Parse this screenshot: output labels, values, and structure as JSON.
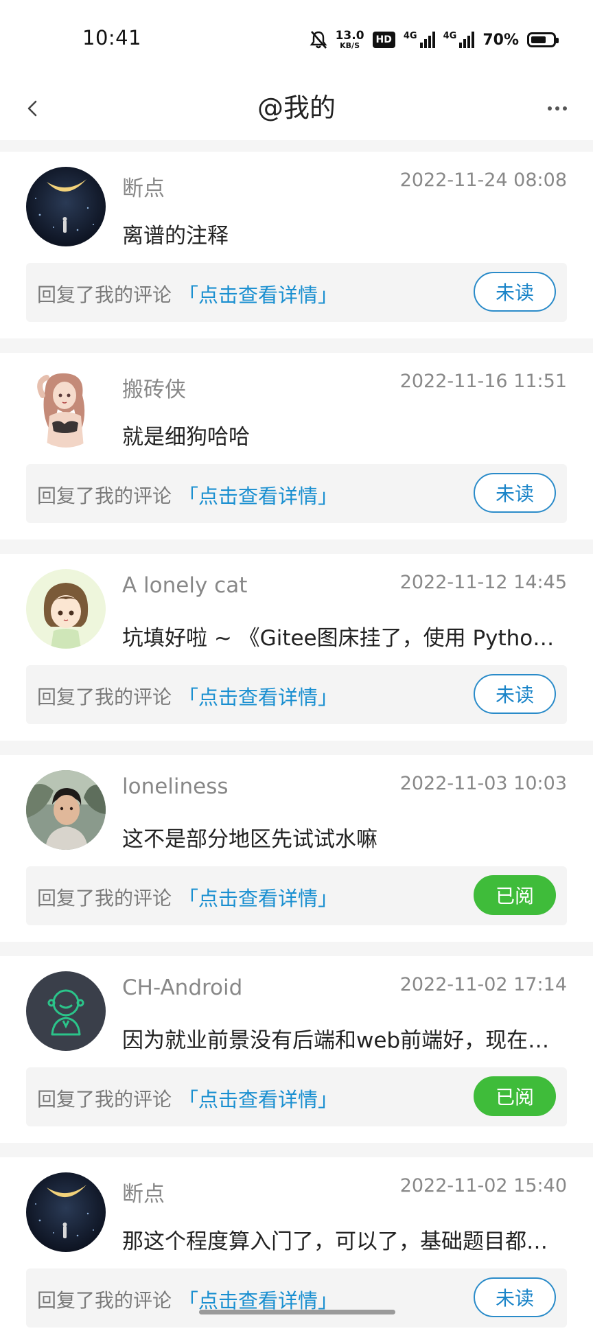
{
  "status_bar": {
    "time": "10:41",
    "net_speed_value": "13.0",
    "net_speed_unit": "KB/S",
    "hd_label": "HD",
    "sig1_label": "4G",
    "sig2_label": "4G",
    "battery_percent": "70%",
    "battery_level": 0.7
  },
  "nav": {
    "title": "@我的",
    "back_icon": "chevron-left-icon",
    "more_icon": "more-horizontal-icon"
  },
  "colors": {
    "link": "#1a8fd0",
    "unread_border": "#2a8bc9",
    "read_fill": "#3fbc3a"
  },
  "items": [
    {
      "username": "断点",
      "time": "2022-11-24 08:08",
      "content": "离谱的注释",
      "reply_prefix": "回复了我的评论",
      "reply_link": "「点击查看详情」",
      "status": "未读",
      "read": false,
      "avatar": "moon-night-avatar"
    },
    {
      "username": "搬砖侠",
      "time": "2022-11-16 11:51",
      "content": "就是细狗哈哈",
      "reply_prefix": "回复了我的评论",
      "reply_link": "「点击查看详情」",
      "status": "未读",
      "read": false,
      "avatar": "anime-girl-avatar"
    },
    {
      "username": "A lonely cat",
      "time": "2022-11-12 14:45",
      "content": "坑填好啦 ~ 《Gitee图床挂了，使用 Python实现图片上传》",
      "reply_prefix": "回复了我的评论",
      "reply_link": "「点击查看详情」",
      "status": "未读",
      "read": false,
      "avatar": "cartoon-girl-avatar"
    },
    {
      "username": "loneliness",
      "time": "2022-11-03 10:03",
      "content": "这不是部分地区先试试水嘛",
      "reply_prefix": "回复了我的评论",
      "reply_link": "「点击查看详情」",
      "status": "已阅",
      "read": true,
      "avatar": "photo-boy-avatar"
    },
    {
      "username": "CH-Android",
      "time": "2022-11-02 17:14",
      "content": "因为就业前景没有后端和web前端好，现在很多人都不学了",
      "reply_prefix": "回复了我的评论",
      "reply_link": "「点击查看详情」",
      "status": "已阅",
      "read": true,
      "avatar": "line-person-avatar"
    },
    {
      "username": "断点",
      "time": "2022-11-02 15:40",
      "content": "那这个程度算入门了，可以了，基础题目都可以做了",
      "reply_prefix": "回复了我的评论",
      "reply_link": "「点击查看详情」",
      "status": "未读",
      "read": false,
      "avatar": "moon-night-avatar"
    }
  ]
}
